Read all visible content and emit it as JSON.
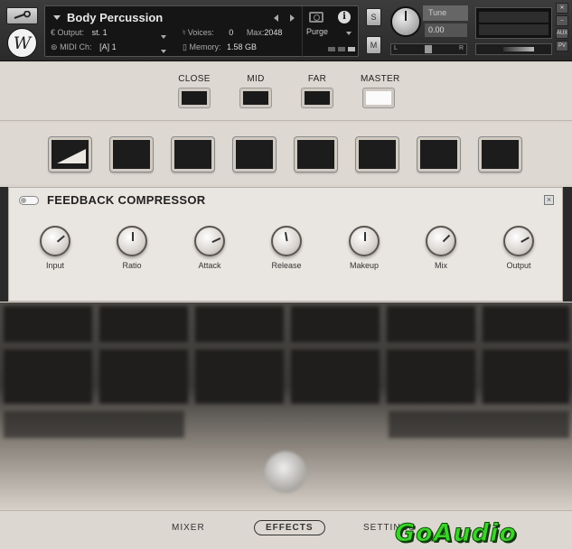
{
  "header": {
    "instrument_name": "Body Percussion",
    "output_label": "Output:",
    "output_value": "st. 1",
    "midi_label": "MIDI Ch:",
    "midi_value": "[A] 1",
    "voices_label": "Voices:",
    "voices_value": "0",
    "max_label": "Max:",
    "max_value": "2048",
    "memory_label": "Memory:",
    "memory_value": "1.58 GB",
    "purge_label": "Purge",
    "solo_label": "S",
    "mute_label": "M",
    "tune_label": "Tune",
    "tune_value": "0.00",
    "pan_left": "L",
    "pan_right": "R",
    "logo_letter": "W",
    "aux_label": "AUX",
    "pv_label": "PV"
  },
  "mics": [
    {
      "label": "CLOSE",
      "active": false
    },
    {
      "label": "MID",
      "active": false
    },
    {
      "label": "FAR",
      "active": false
    },
    {
      "label": "MASTER",
      "active": true
    }
  ],
  "fx_slots": [
    {
      "icon": "compressor-ramp-icon",
      "filled": true
    },
    {
      "icon": "",
      "filled": false
    },
    {
      "icon": "",
      "filled": false
    },
    {
      "icon": "",
      "filled": false
    },
    {
      "icon": "",
      "filled": false
    },
    {
      "icon": "",
      "filled": false
    },
    {
      "icon": "",
      "filled": false
    },
    {
      "icon": "",
      "filled": false
    }
  ],
  "compressor": {
    "title": "FEEDBACK COMPRESSOR",
    "knobs": [
      {
        "label": "Input",
        "angle": -40
      },
      {
        "label": "Ratio",
        "angle": -90
      },
      {
        "label": "Attack",
        "angle": -25
      },
      {
        "label": "Release",
        "angle": -100
      },
      {
        "label": "Makeup",
        "angle": -90
      },
      {
        "label": "Mix",
        "angle": -45
      },
      {
        "label": "Output",
        "angle": -30
      }
    ]
  },
  "footer": {
    "tabs": [
      {
        "label": "MIXER",
        "active": false
      },
      {
        "label": "EFFECTS",
        "active": true
      },
      {
        "label": "SETTINGS",
        "active": false
      }
    ],
    "watermark": "GoAudio"
  },
  "colors": {
    "accent_active": "#fbfbfb",
    "slot_bg": "#1c1c1c",
    "panel_bg": "#e9e5e0",
    "watermark": "#3bd42a"
  }
}
